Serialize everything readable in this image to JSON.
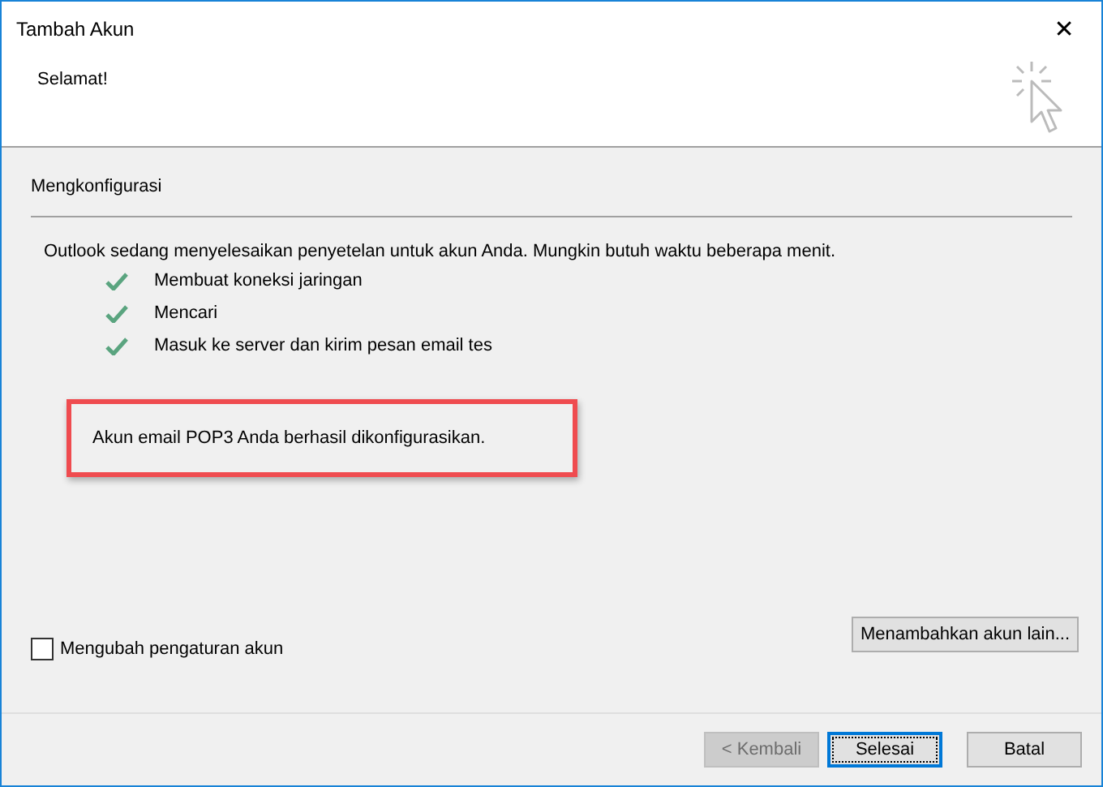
{
  "window": {
    "title": "Tambah Akun",
    "close": "✕"
  },
  "header": {
    "title": "Selamat!"
  },
  "section": {
    "title": "Mengkonfigurasi"
  },
  "intro": "Outlook sedang menyelesaikan penyetelan untuk akun Anda. Mungkin butuh waktu beberapa menit.",
  "steps": [
    {
      "label": "Membuat koneksi jaringan",
      "done": true
    },
    {
      "label": "Mencari",
      "done": true
    },
    {
      "label": "Masuk ke server dan kirim pesan email tes",
      "done": true
    }
  ],
  "result": {
    "text": "Akun email POP3 Anda berhasil dikonfigurasikan.",
    "highlighted": true
  },
  "change_settings": {
    "label": "Mengubah pengaturan akun",
    "checked": false
  },
  "add_account_button": "Menambahkan akun lain...",
  "buttons": [
    {
      "label": "< Kembali",
      "disabled": true,
      "default": false
    },
    {
      "label": "Selesai",
      "disabled": false,
      "default": true
    },
    {
      "label": "Batal",
      "disabled": false,
      "default": false
    }
  ]
}
